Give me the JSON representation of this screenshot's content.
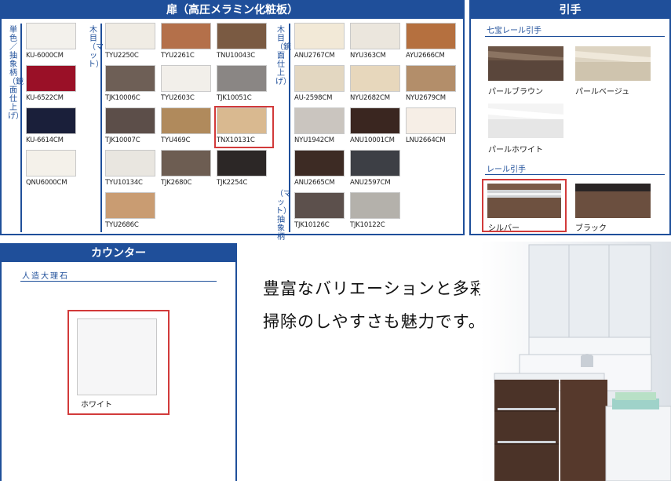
{
  "door": {
    "title": "扉（高圧メラミン化粧板）",
    "group_solid": "単色／抽象柄（鏡面仕上げ）",
    "group_wood_matte": "木目（マット）",
    "group_wood_mirror": "木目（鏡面仕上げ）",
    "group_abstract_matte": "（マット）抽象柄",
    "swatches": [
      {
        "code": "KU-6000CM",
        "color": "#f3f1ec"
      },
      {
        "code": "KU-6522CM",
        "color": "#9a1027"
      },
      {
        "code": "KU-6614CM",
        "color": "#1a1f3a"
      },
      {
        "code": "QNU6000CM",
        "color": "#f4f1ea"
      },
      {
        "code": "TYU2250C",
        "color": "#f0ece4"
      },
      {
        "code": "TYU2261C",
        "color": "#b4704a"
      },
      {
        "code": "TNU10043C",
        "color": "#7a5a42"
      },
      {
        "code": "TJK10006C",
        "color": "#6e5f56"
      },
      {
        "code": "TYU2603C",
        "color": "#f2efea"
      },
      {
        "code": "TJK10051C",
        "color": "#8a8684"
      },
      {
        "code": "TJK10007C",
        "color": "#5c4e49"
      },
      {
        "code": "TYU469C",
        "color": "#b08a5c"
      },
      {
        "code": "TNX10131C",
        "color": "#d9b990"
      },
      {
        "code": "TYU10134C",
        "color": "#e9e6e0"
      },
      {
        "code": "TJK2680C",
        "color": "#6d5d52"
      },
      {
        "code": "TJK2254C",
        "color": "#2c2726"
      },
      {
        "code": "TYU2686C",
        "color": "#c99c72"
      },
      {
        "code": "ANU2767CM",
        "color": "#f2e9d7"
      },
      {
        "code": "NYU363CM",
        "color": "#ebe6dd"
      },
      {
        "code": "AYU2666CM",
        "color": "#b5703f"
      },
      {
        "code": "AU-2598CM",
        "color": "#e3d7c1"
      },
      {
        "code": "NYU2682CM",
        "color": "#e7d7bc"
      },
      {
        "code": "NYU2679CM",
        "color": "#b38e6a"
      },
      {
        "code": "NYU1942CM",
        "color": "#cac5bf"
      },
      {
        "code": "ANU10001CM",
        "color": "#3a2620"
      },
      {
        "code": "LNU2664CM",
        "color": "#f6eee6"
      },
      {
        "code": "ANU2665CM",
        "color": "#3d2b24"
      },
      {
        "code": "ANU2597CM",
        "color": "#3d3f45"
      },
      {
        "code": "TJK10126C",
        "color": "#5c504c"
      },
      {
        "code": "TJK10122C",
        "color": "#b4b1ab"
      }
    ]
  },
  "handle": {
    "title": "引手",
    "group_rainbow": "七宝レール引手",
    "group_rail": "レール引手",
    "options": [
      {
        "label": "パールブラウン"
      },
      {
        "label": "パールベージュ"
      },
      {
        "label": "パールホワイト"
      },
      {
        "label": "シルバー"
      },
      {
        "label": "ブラック"
      }
    ]
  },
  "counter": {
    "title": "カウンター",
    "material": "人造大理石",
    "swatch_label": "ホワイト"
  },
  "slogan": {
    "line1": "豊富なバリエーションと多彩なカラー。",
    "line2": "掃除のしやすさも魅力です。"
  },
  "colors": {
    "accent": "#1f4f9a",
    "selected_border": "#d23a3a"
  }
}
